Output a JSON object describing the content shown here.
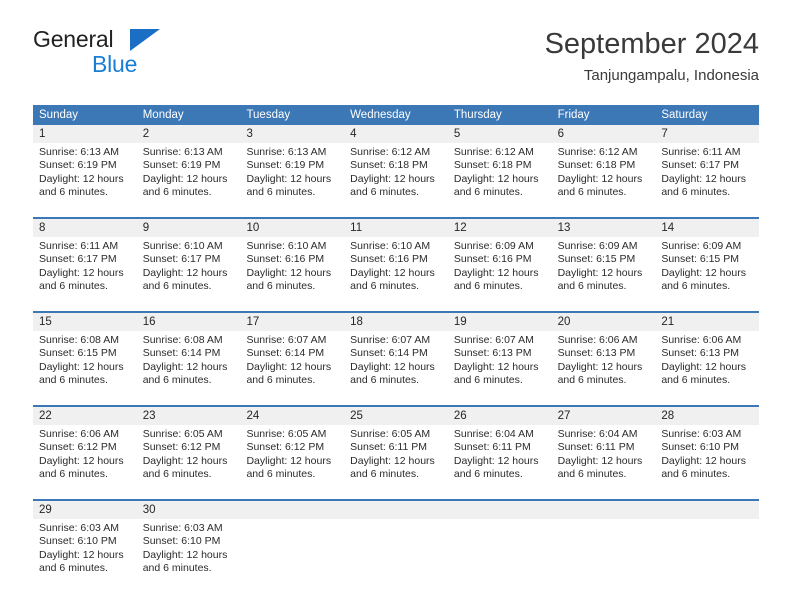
{
  "brand": {
    "line1": "General",
    "line2": "Blue",
    "triangle_color": "#1a6fc4",
    "blue_text_color": "#1a7fd4"
  },
  "header": {
    "title": "September 2024",
    "subtitle": "Tanjungampalu, Indonesia"
  },
  "colors": {
    "header_blue": "#3c77b6",
    "date_band_gray": "#f0f0f0",
    "text": "#2b2b2b"
  },
  "calendar": {
    "weekdays": [
      "Sunday",
      "Monday",
      "Tuesday",
      "Wednesday",
      "Thursday",
      "Friday",
      "Saturday"
    ],
    "weeks": [
      [
        {
          "day": "1",
          "sunrise": "Sunrise: 6:13 AM",
          "sunset": "Sunset: 6:19 PM",
          "daylight1": "Daylight: 12 hours",
          "daylight2": "and 6 minutes."
        },
        {
          "day": "2",
          "sunrise": "Sunrise: 6:13 AM",
          "sunset": "Sunset: 6:19 PM",
          "daylight1": "Daylight: 12 hours",
          "daylight2": "and 6 minutes."
        },
        {
          "day": "3",
          "sunrise": "Sunrise: 6:13 AM",
          "sunset": "Sunset: 6:19 PM",
          "daylight1": "Daylight: 12 hours",
          "daylight2": "and 6 minutes."
        },
        {
          "day": "4",
          "sunrise": "Sunrise: 6:12 AM",
          "sunset": "Sunset: 6:18 PM",
          "daylight1": "Daylight: 12 hours",
          "daylight2": "and 6 minutes."
        },
        {
          "day": "5",
          "sunrise": "Sunrise: 6:12 AM",
          "sunset": "Sunset: 6:18 PM",
          "daylight1": "Daylight: 12 hours",
          "daylight2": "and 6 minutes."
        },
        {
          "day": "6",
          "sunrise": "Sunrise: 6:12 AM",
          "sunset": "Sunset: 6:18 PM",
          "daylight1": "Daylight: 12 hours",
          "daylight2": "and 6 minutes."
        },
        {
          "day": "7",
          "sunrise": "Sunrise: 6:11 AM",
          "sunset": "Sunset: 6:17 PM",
          "daylight1": "Daylight: 12 hours",
          "daylight2": "and 6 minutes."
        }
      ],
      [
        {
          "day": "8",
          "sunrise": "Sunrise: 6:11 AM",
          "sunset": "Sunset: 6:17 PM",
          "daylight1": "Daylight: 12 hours",
          "daylight2": "and 6 minutes."
        },
        {
          "day": "9",
          "sunrise": "Sunrise: 6:10 AM",
          "sunset": "Sunset: 6:17 PM",
          "daylight1": "Daylight: 12 hours",
          "daylight2": "and 6 minutes."
        },
        {
          "day": "10",
          "sunrise": "Sunrise: 6:10 AM",
          "sunset": "Sunset: 6:16 PM",
          "daylight1": "Daylight: 12 hours",
          "daylight2": "and 6 minutes."
        },
        {
          "day": "11",
          "sunrise": "Sunrise: 6:10 AM",
          "sunset": "Sunset: 6:16 PM",
          "daylight1": "Daylight: 12 hours",
          "daylight2": "and 6 minutes."
        },
        {
          "day": "12",
          "sunrise": "Sunrise: 6:09 AM",
          "sunset": "Sunset: 6:16 PM",
          "daylight1": "Daylight: 12 hours",
          "daylight2": "and 6 minutes."
        },
        {
          "day": "13",
          "sunrise": "Sunrise: 6:09 AM",
          "sunset": "Sunset: 6:15 PM",
          "daylight1": "Daylight: 12 hours",
          "daylight2": "and 6 minutes."
        },
        {
          "day": "14",
          "sunrise": "Sunrise: 6:09 AM",
          "sunset": "Sunset: 6:15 PM",
          "daylight1": "Daylight: 12 hours",
          "daylight2": "and 6 minutes."
        }
      ],
      [
        {
          "day": "15",
          "sunrise": "Sunrise: 6:08 AM",
          "sunset": "Sunset: 6:15 PM",
          "daylight1": "Daylight: 12 hours",
          "daylight2": "and 6 minutes."
        },
        {
          "day": "16",
          "sunrise": "Sunrise: 6:08 AM",
          "sunset": "Sunset: 6:14 PM",
          "daylight1": "Daylight: 12 hours",
          "daylight2": "and 6 minutes."
        },
        {
          "day": "17",
          "sunrise": "Sunrise: 6:07 AM",
          "sunset": "Sunset: 6:14 PM",
          "daylight1": "Daylight: 12 hours",
          "daylight2": "and 6 minutes."
        },
        {
          "day": "18",
          "sunrise": "Sunrise: 6:07 AM",
          "sunset": "Sunset: 6:14 PM",
          "daylight1": "Daylight: 12 hours",
          "daylight2": "and 6 minutes."
        },
        {
          "day": "19",
          "sunrise": "Sunrise: 6:07 AM",
          "sunset": "Sunset: 6:13 PM",
          "daylight1": "Daylight: 12 hours",
          "daylight2": "and 6 minutes."
        },
        {
          "day": "20",
          "sunrise": "Sunrise: 6:06 AM",
          "sunset": "Sunset: 6:13 PM",
          "daylight1": "Daylight: 12 hours",
          "daylight2": "and 6 minutes."
        },
        {
          "day": "21",
          "sunrise": "Sunrise: 6:06 AM",
          "sunset": "Sunset: 6:13 PM",
          "daylight1": "Daylight: 12 hours",
          "daylight2": "and 6 minutes."
        }
      ],
      [
        {
          "day": "22",
          "sunrise": "Sunrise: 6:06 AM",
          "sunset": "Sunset: 6:12 PM",
          "daylight1": "Daylight: 12 hours",
          "daylight2": "and 6 minutes."
        },
        {
          "day": "23",
          "sunrise": "Sunrise: 6:05 AM",
          "sunset": "Sunset: 6:12 PM",
          "daylight1": "Daylight: 12 hours",
          "daylight2": "and 6 minutes."
        },
        {
          "day": "24",
          "sunrise": "Sunrise: 6:05 AM",
          "sunset": "Sunset: 6:12 PM",
          "daylight1": "Daylight: 12 hours",
          "daylight2": "and 6 minutes."
        },
        {
          "day": "25",
          "sunrise": "Sunrise: 6:05 AM",
          "sunset": "Sunset: 6:11 PM",
          "daylight1": "Daylight: 12 hours",
          "daylight2": "and 6 minutes."
        },
        {
          "day": "26",
          "sunrise": "Sunrise: 6:04 AM",
          "sunset": "Sunset: 6:11 PM",
          "daylight1": "Daylight: 12 hours",
          "daylight2": "and 6 minutes."
        },
        {
          "day": "27",
          "sunrise": "Sunrise: 6:04 AM",
          "sunset": "Sunset: 6:11 PM",
          "daylight1": "Daylight: 12 hours",
          "daylight2": "and 6 minutes."
        },
        {
          "day": "28",
          "sunrise": "Sunrise: 6:03 AM",
          "sunset": "Sunset: 6:10 PM",
          "daylight1": "Daylight: 12 hours",
          "daylight2": "and 6 minutes."
        }
      ],
      [
        {
          "day": "29",
          "sunrise": "Sunrise: 6:03 AM",
          "sunset": "Sunset: 6:10 PM",
          "daylight1": "Daylight: 12 hours",
          "daylight2": "and 6 minutes."
        },
        {
          "day": "30",
          "sunrise": "Sunrise: 6:03 AM",
          "sunset": "Sunset: 6:10 PM",
          "daylight1": "Daylight: 12 hours",
          "daylight2": "and 6 minutes."
        },
        {
          "day": "",
          "sunrise": "",
          "sunset": "",
          "daylight1": "",
          "daylight2": ""
        },
        {
          "day": "",
          "sunrise": "",
          "sunset": "",
          "daylight1": "",
          "daylight2": ""
        },
        {
          "day": "",
          "sunrise": "",
          "sunset": "",
          "daylight1": "",
          "daylight2": ""
        },
        {
          "day": "",
          "sunrise": "",
          "sunset": "",
          "daylight1": "",
          "daylight2": ""
        },
        {
          "day": "",
          "sunrise": "",
          "sunset": "",
          "daylight1": "",
          "daylight2": ""
        }
      ]
    ]
  }
}
